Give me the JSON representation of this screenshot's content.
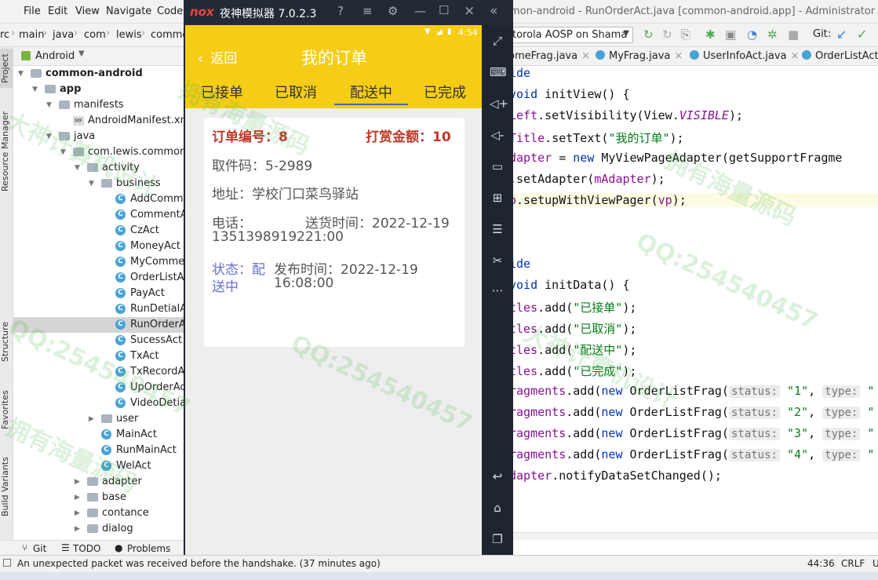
{
  "ide": {
    "menu": [
      "File",
      "Edit",
      "View",
      "Navigate",
      "Code"
    ],
    "title": "mon-android - RunOrderAct.java [common-android.app] - Administrator",
    "breadcrumbs": [
      "rc",
      "main",
      "java",
      "com",
      "lewis",
      "commo"
    ],
    "device": "torola AOSP on Shama",
    "git_label": "Git:",
    "project_view": "Android",
    "side_tabs": {
      "project": "Project",
      "resource_manager": "Resource Manager",
      "structure": "Structure",
      "favorites": "Favorites",
      "build_variants": "Build Variants"
    },
    "tree": [
      {
        "label": "common-android",
        "bold": true,
        "indent": 0,
        "type": "module",
        "arrow": "open"
      },
      {
        "label": "app",
        "bold": true,
        "indent": 1,
        "type": "module",
        "arrow": "open"
      },
      {
        "label": "manifests",
        "indent": 2,
        "type": "folder",
        "arrow": "open"
      },
      {
        "label": "AndroidManifest.xml",
        "indent": 3,
        "type": "manifest",
        "arrow": ""
      },
      {
        "label": "java",
        "indent": 2,
        "type": "folder",
        "arrow": "open"
      },
      {
        "label": "com.lewis.common",
        "indent": 3,
        "type": "folder",
        "arrow": "open"
      },
      {
        "label": "activity",
        "indent": 4,
        "type": "folder",
        "arrow": "open"
      },
      {
        "label": "business",
        "indent": 5,
        "type": "folder",
        "arrow": "open"
      },
      {
        "label": "AddComme",
        "indent": 6,
        "type": "class",
        "arrow": ""
      },
      {
        "label": "CommentA",
        "indent": 6,
        "type": "class",
        "arrow": ""
      },
      {
        "label": "CzAct",
        "indent": 6,
        "type": "class",
        "arrow": ""
      },
      {
        "label": "MoneyAct",
        "indent": 6,
        "type": "class",
        "arrow": ""
      },
      {
        "label": "MyCommer",
        "indent": 6,
        "type": "class",
        "arrow": ""
      },
      {
        "label": "OrderListAc",
        "indent": 6,
        "type": "class",
        "arrow": ""
      },
      {
        "label": "PayAct",
        "indent": 6,
        "type": "class",
        "arrow": ""
      },
      {
        "label": "RunDetialAc",
        "indent": 6,
        "type": "class",
        "arrow": ""
      },
      {
        "label": "RunOrderA",
        "indent": 6,
        "type": "class",
        "arrow": "",
        "selected": true
      },
      {
        "label": "SucessAct",
        "indent": 6,
        "type": "class",
        "arrow": ""
      },
      {
        "label": "TxAct",
        "indent": 6,
        "type": "class",
        "arrow": ""
      },
      {
        "label": "TxRecordAc",
        "indent": 6,
        "type": "class",
        "arrow": ""
      },
      {
        "label": "UpOrderAc",
        "indent": 6,
        "type": "class",
        "arrow": ""
      },
      {
        "label": "VideoDetia",
        "indent": 6,
        "type": "class",
        "arrow": ""
      },
      {
        "label": "user",
        "indent": 5,
        "type": "folder",
        "arrow": "closed"
      },
      {
        "label": "MainAct",
        "indent": 5,
        "type": "class",
        "arrow": ""
      },
      {
        "label": "RunMainAct",
        "indent": 5,
        "type": "class",
        "arrow": ""
      },
      {
        "label": "WelAct",
        "indent": 5,
        "type": "class",
        "arrow": ""
      },
      {
        "label": "adapter",
        "indent": 4,
        "type": "folder",
        "arrow": "closed"
      },
      {
        "label": "base",
        "indent": 4,
        "type": "folder",
        "arrow": "closed"
      },
      {
        "label": "contance",
        "indent": 4,
        "type": "folder",
        "arrow": "closed"
      },
      {
        "label": "dialog",
        "indent": 4,
        "type": "folder",
        "arrow": "closed"
      }
    ],
    "bottom_tabs": [
      "Git",
      "TODO",
      "Problems"
    ],
    "status_message": "An unexpected packet was received before the handshake. (37 minutes ago)",
    "status_right": {
      "position": "44:36",
      "line_ending": "CRLF",
      "encoding": "U"
    },
    "editor_tabs": [
      "omeFrag.java",
      "MyFrag.java",
      "UserInfoAct.java",
      "OrderListAct.j"
    ],
    "code_lines": [
      {
        "parts": [
          {
            "t": "ide",
            "c": "kw"
          }
        ]
      },
      {
        "parts": [
          {
            "t": "void ",
            "c": "kw"
          },
          {
            "t": "initView() {",
            "c": ""
          }
        ]
      },
      {
        "parts": [
          {
            "t": "Left",
            "c": "fld"
          },
          {
            "t": ".setVisibility(View.",
            "c": ""
          },
          {
            "t": "VISIBLE",
            "c": "fld it"
          },
          {
            "t": ");",
            "c": ""
          }
        ]
      },
      {
        "parts": [
          {
            "t": "Title",
            "c": "fld"
          },
          {
            "t": ".setText(",
            "c": ""
          },
          {
            "t": "\"我的订单\"",
            "c": "str"
          },
          {
            "t": ");",
            "c": ""
          }
        ]
      },
      {
        "parts": [
          {
            "t": "dapter",
            "c": "fld"
          },
          {
            "t": " = ",
            "c": ""
          },
          {
            "t": "new ",
            "c": "kw"
          },
          {
            "t": "MyViewPageAdapter(getSupportFragme",
            "c": ""
          }
        ]
      },
      {
        "parts": [
          {
            "t": ".setAdapter(",
            "c": ""
          },
          {
            "t": "mAdapter",
            "c": "fld"
          },
          {
            "t": ");",
            "c": ""
          }
        ]
      },
      {
        "hl": true,
        "parts": [
          {
            "t": "o",
            "c": "fld"
          },
          {
            "t": ".setupWithViewPager(",
            "c": ""
          },
          {
            "t": "vp",
            "c": "fld"
          },
          {
            "t": ");",
            "c": ""
          }
        ]
      },
      {
        "parts": []
      },
      {
        "parts": []
      },
      {
        "parts": [
          {
            "t": "ide",
            "c": "kw"
          }
        ]
      },
      {
        "parts": [
          {
            "t": "void ",
            "c": "kw"
          },
          {
            "t": "initData() {",
            "c": ""
          }
        ]
      },
      {
        "parts": [
          {
            "t": "tles",
            "c": "fld"
          },
          {
            "t": ".add(",
            "c": ""
          },
          {
            "t": "\"已接单\"",
            "c": "str"
          },
          {
            "t": ");",
            "c": ""
          }
        ]
      },
      {
        "parts": [
          {
            "t": "tles",
            "c": "fld"
          },
          {
            "t": ".add(",
            "c": ""
          },
          {
            "t": "\"已取消\"",
            "c": "str"
          },
          {
            "t": ");",
            "c": ""
          }
        ]
      },
      {
        "parts": [
          {
            "t": "tles",
            "c": "fld"
          },
          {
            "t": ".add(",
            "c": ""
          },
          {
            "t": "\"配送中\"",
            "c": "str"
          },
          {
            "t": ");",
            "c": ""
          }
        ]
      },
      {
        "parts": [
          {
            "t": "tles",
            "c": "fld"
          },
          {
            "t": ".add(",
            "c": ""
          },
          {
            "t": "\"已完成\"",
            "c": "str"
          },
          {
            "t": ");",
            "c": ""
          }
        ]
      },
      {
        "parts": [
          {
            "t": "ragments",
            "c": "fld"
          },
          {
            "t": ".add(",
            "c": ""
          },
          {
            "t": "new ",
            "c": "kw"
          },
          {
            "t": "OrderListFrag(",
            "c": ""
          },
          {
            "t": "status:",
            "c": "hint"
          },
          {
            "t": " \"1\"",
            "c": "str"
          },
          {
            "t": ", ",
            "c": ""
          },
          {
            "t": "type:",
            "c": "hint"
          },
          {
            "t": " \"",
            "c": "str"
          }
        ]
      },
      {
        "parts": [
          {
            "t": "ragments",
            "c": "fld"
          },
          {
            "t": ".add(",
            "c": ""
          },
          {
            "t": "new ",
            "c": "kw"
          },
          {
            "t": "OrderListFrag(",
            "c": ""
          },
          {
            "t": "status:",
            "c": "hint"
          },
          {
            "t": " \"2\"",
            "c": "str"
          },
          {
            "t": ", ",
            "c": ""
          },
          {
            "t": "type:",
            "c": "hint"
          },
          {
            "t": " \"",
            "c": "str"
          }
        ]
      },
      {
        "parts": [
          {
            "t": "ragments",
            "c": "fld"
          },
          {
            "t": ".add(",
            "c": ""
          },
          {
            "t": "new ",
            "c": "kw"
          },
          {
            "t": "OrderListFrag(",
            "c": ""
          },
          {
            "t": "status:",
            "c": "hint"
          },
          {
            "t": " \"3\"",
            "c": "str"
          },
          {
            "t": ", ",
            "c": ""
          },
          {
            "t": "type:",
            "c": "hint"
          },
          {
            "t": " \"",
            "c": "str"
          }
        ]
      },
      {
        "parts": [
          {
            "t": "ragments",
            "c": "fld"
          },
          {
            "t": ".add(",
            "c": ""
          },
          {
            "t": "new ",
            "c": "kw"
          },
          {
            "t": "OrderListFrag(",
            "c": ""
          },
          {
            "t": "status:",
            "c": "hint"
          },
          {
            "t": " \"4\"",
            "c": "str"
          },
          {
            "t": ", ",
            "c": ""
          },
          {
            "t": "type:",
            "c": "hint"
          },
          {
            "t": " \"",
            "c": "str"
          }
        ]
      },
      {
        "parts": [
          {
            "t": "dapter",
            "c": "fld"
          },
          {
            "t": ".notifyDataSetChanged();",
            "c": ""
          }
        ]
      }
    ]
  },
  "emulator": {
    "logo": "nox",
    "title": "夜神模拟器 7.0.2.3",
    "status_time": "4:54",
    "app": {
      "back_label": "返回",
      "title": "我的订单",
      "tabs": [
        "已接单",
        "已取消",
        "配送中",
        "已完成"
      ],
      "active_tab": 2,
      "order": {
        "number_label": "订单编号：8",
        "reward_label": "打赏金额：10",
        "pickup_code": "取件码：5-2989",
        "address": "地址：学校门口菜鸟驿站",
        "phone_label": "电话：",
        "phone_value": "13513989192",
        "delivery_label": "送货时间：2022-12-19",
        "delivery_time": "21:00",
        "status_label_1": "状态：配",
        "status_label_2": "送中",
        "publish_label": "发布时间：2022-12-19",
        "publish_time": "16:08:00"
      }
    }
  },
  "watermarks": [
    "QQ:254540457",
    "大神计算机设计",
    "拥有海量源码"
  ],
  "colors": {
    "app_bar": "#f5cd16",
    "order_red": "#c0392b",
    "status_blue": "#6a6ed8",
    "nox_dark": "#222a36"
  }
}
